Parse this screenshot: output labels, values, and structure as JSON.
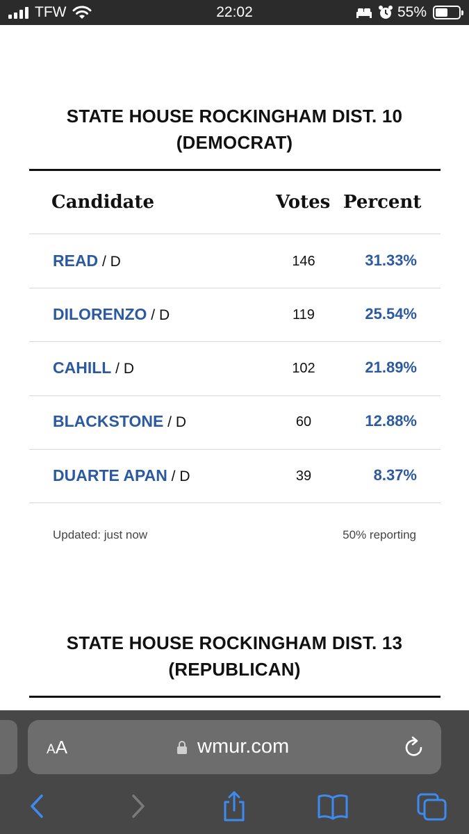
{
  "status_bar": {
    "carrier": "TFW",
    "time": "22:02",
    "battery": "55%",
    "battery_level": 0.55,
    "icons": [
      "signal-icon",
      "wifi-icon",
      "bed-icon",
      "alarm-icon",
      "battery-icon"
    ]
  },
  "sections": [
    {
      "title_line1": "STATE HOUSE ROCKINGHAM DIST. 10",
      "title_line2": "(DEMOCRAT)",
      "headers": {
        "candidate": "Candidate",
        "votes": "Votes",
        "percent": "Percent"
      },
      "rows": [
        {
          "name": "READ",
          "party": " / D",
          "votes": "146",
          "percent": "31.33%"
        },
        {
          "name": "DILORENZO",
          "party": " / D",
          "votes": "119",
          "percent": "25.54%"
        },
        {
          "name": "CAHILL",
          "party": " / D",
          "votes": "102",
          "percent": "21.89%"
        },
        {
          "name": "BLACKSTONE",
          "party": " / D",
          "votes": "60",
          "percent": "12.88%"
        },
        {
          "name": "DUARTE APAN",
          "party": " / D",
          "votes": "39",
          "percent": "8.37%"
        }
      ],
      "updated": "Updated: just now",
      "reporting": "50% reporting"
    },
    {
      "title_line1": "STATE HOUSE ROCKINGHAM DIST. 13",
      "title_line2": "(REPUBLICAN)"
    }
  ],
  "browser": {
    "text_size_label_small": "A",
    "text_size_label_large": "A",
    "domain": "wmur.com",
    "toolbar": [
      "back-icon",
      "forward-icon",
      "share-icon",
      "bookmarks-icon",
      "tabs-icon"
    ]
  },
  "colors": {
    "link_blue": "#2c5aa0",
    "status_bar_bg": "#2b2b2b",
    "browser_bar_bg": "#474747"
  }
}
